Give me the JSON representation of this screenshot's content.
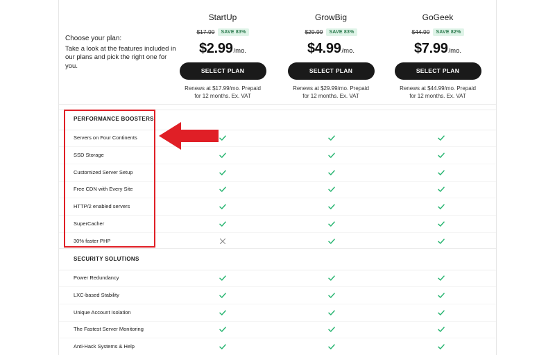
{
  "intro": {
    "title": "Choose your plan:",
    "text": "Take a look at the features included in our plans and pick the right one for you."
  },
  "plans": [
    {
      "name": "StartUp",
      "old_price": "$17.99",
      "save": "SAVE 83%",
      "price": "$2.99",
      "per": "/mo.",
      "button": "SELECT PLAN",
      "renews": "Renews at $17.99/mo. Prepaid for 12 months. Ex. VAT"
    },
    {
      "name": "GrowBig",
      "old_price": "$29.99",
      "save": "SAVE 83%",
      "price": "$4.99",
      "per": "/mo.",
      "button": "SELECT PLAN",
      "renews": "Renews at $29.99/mo. Prepaid for 12 months. Ex. VAT"
    },
    {
      "name": "GoGeek",
      "old_price": "$44.99",
      "save": "SAVE 82%",
      "price": "$7.99",
      "per": "/mo.",
      "button": "SELECT PLAN",
      "renews": "Renews at $44.99/mo. Prepaid for 12 months. Ex. VAT"
    }
  ],
  "sections": [
    {
      "title": "PERFORMANCE BOOSTERS",
      "rows": [
        {
          "label": "Servers on Four Continents",
          "marks": [
            "check",
            "check",
            "check"
          ]
        },
        {
          "label": "SSD Storage",
          "marks": [
            "check",
            "check",
            "check"
          ]
        },
        {
          "label": "Customized Server Setup",
          "marks": [
            "check",
            "check",
            "check"
          ]
        },
        {
          "label": "Free CDN with Every Site",
          "marks": [
            "check",
            "check",
            "check"
          ]
        },
        {
          "label": "HTTP/2 enabled servers",
          "marks": [
            "check",
            "check",
            "check"
          ]
        },
        {
          "label": "SuperCacher",
          "marks": [
            "check",
            "check",
            "check"
          ]
        },
        {
          "label": "30% faster PHP",
          "marks": [
            "cross",
            "check",
            "check"
          ]
        }
      ]
    },
    {
      "title": "SECURITY SOLUTIONS",
      "rows": [
        {
          "label": "Power Redundancy",
          "marks": [
            "check",
            "check",
            "check"
          ]
        },
        {
          "label": "LXC-based Stability",
          "marks": [
            "check",
            "check",
            "check"
          ]
        },
        {
          "label": "Unique Account Isolation",
          "marks": [
            "check",
            "check",
            "check"
          ]
        },
        {
          "label": "The Fastest Server Monitoring",
          "marks": [
            "check",
            "check",
            "check"
          ]
        },
        {
          "label": "Anti-Hack Systems & Help",
          "marks": [
            "check",
            "check",
            "check"
          ]
        }
      ]
    }
  ],
  "colors": {
    "check": "#2bb673",
    "cross": "#8a8a8a",
    "annotation": "#e01f26",
    "button": "#1a1a1a",
    "badge_bg": "#dff4e8",
    "badge_text": "#2c7a4e"
  },
  "icons": {
    "check": "checkmark-icon",
    "cross": "cross-icon",
    "annotation_arrow": "left-arrow-icon"
  }
}
